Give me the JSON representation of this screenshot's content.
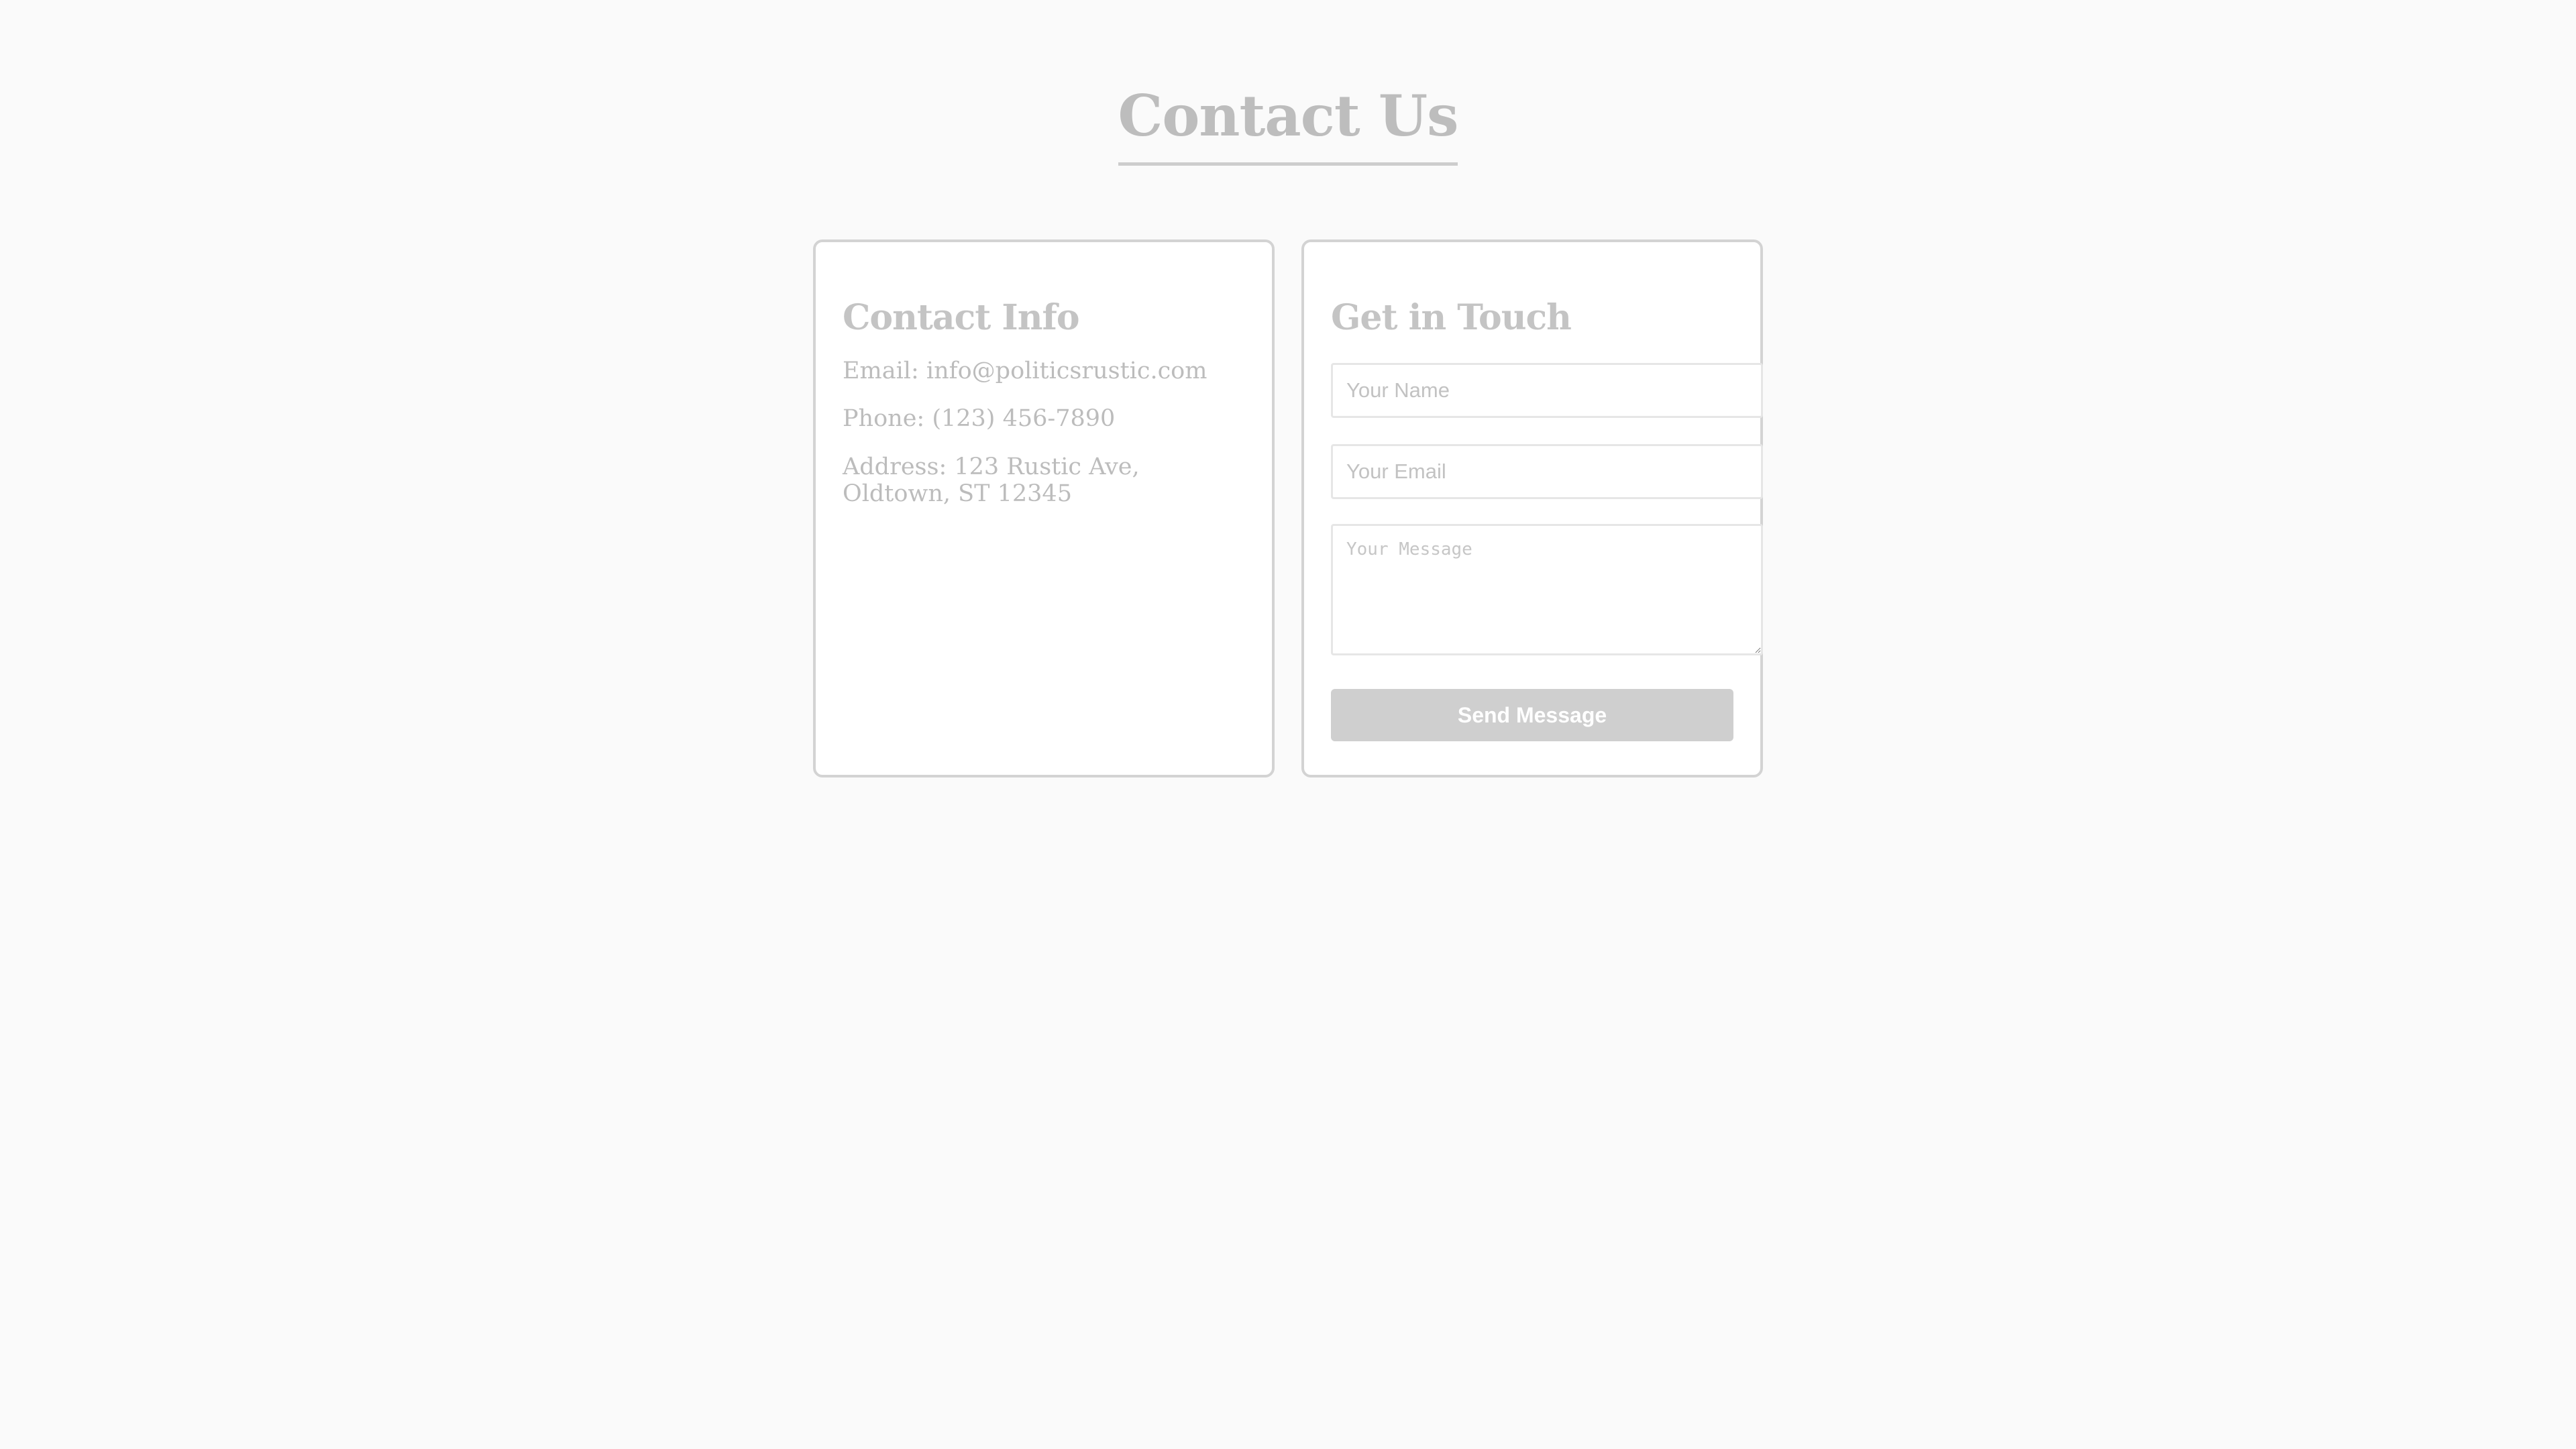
{
  "page": {
    "title": "Contact Us"
  },
  "contact_info": {
    "heading": "Contact Info",
    "email": "Email: info@politicsrustic.com",
    "phone": "Phone: (123) 456-7890",
    "address": "Address: 123 Rustic Ave, Oldtown, ST 12345"
  },
  "get_in_touch": {
    "heading": "Get in Touch",
    "name_placeholder": "Your Name",
    "email_placeholder": "Your Email",
    "message_placeholder": "Your Message",
    "send_label": "Send Message"
  },
  "colors": {
    "background": "#fafafa",
    "card_border": "#d3d3d3",
    "button_background": "#cfcfcf",
    "text_muted": "#bcbcbc"
  }
}
